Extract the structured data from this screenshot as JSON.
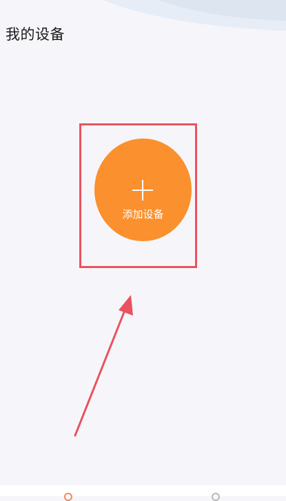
{
  "header": {
    "title": "我的设备"
  },
  "main": {
    "add_device_label": "添加设备",
    "accent_color": "#fb902e",
    "annotation_color": "#e9525e"
  },
  "tab_bar": {
    "items": [
      {
        "icon": "device-tab-icon",
        "active": true
      },
      {
        "icon": "profile-tab-icon",
        "active": false
      }
    ]
  }
}
